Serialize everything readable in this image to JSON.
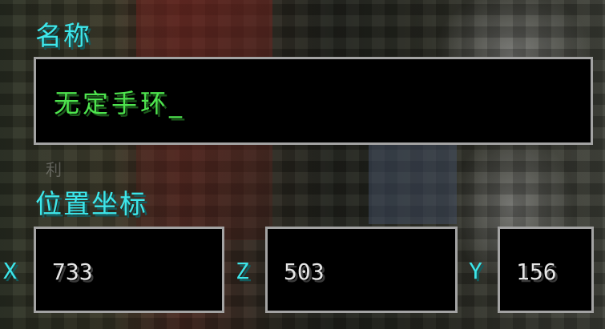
{
  "name_section": {
    "label": "名称",
    "value": "无定手环",
    "cursor": "_"
  },
  "background_hint": "利",
  "position_section": {
    "label": "位置坐标",
    "x_label": "X",
    "x_value": "733",
    "z_label": "Z",
    "z_value": "503",
    "y_label": "Y",
    "y_value": "156"
  },
  "colors": {
    "label": "#3de6ea",
    "input_text": "#4ee44e",
    "border": "#a3a3a3"
  }
}
